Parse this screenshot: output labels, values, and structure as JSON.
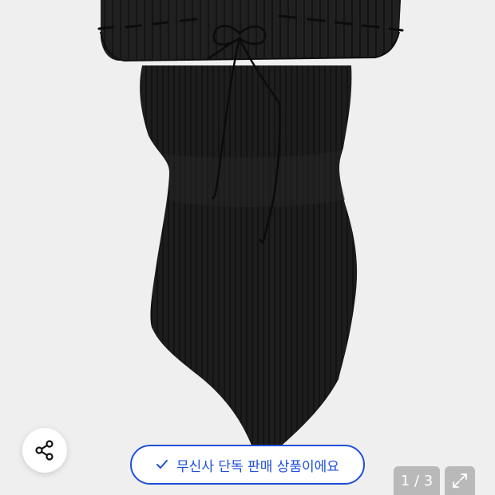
{
  "gallery": {
    "image_alt": "black ribbed knit top with drawstring tie",
    "page_indicator": "1 / 3"
  },
  "share_button": {
    "icon": "share-icon"
  },
  "exclusive_badge": {
    "icon": "check-icon",
    "label": "무신사 단독 판매 상품이에요",
    "color": "#1e4fd8"
  },
  "expand_button": {
    "icon": "expand-icon"
  }
}
